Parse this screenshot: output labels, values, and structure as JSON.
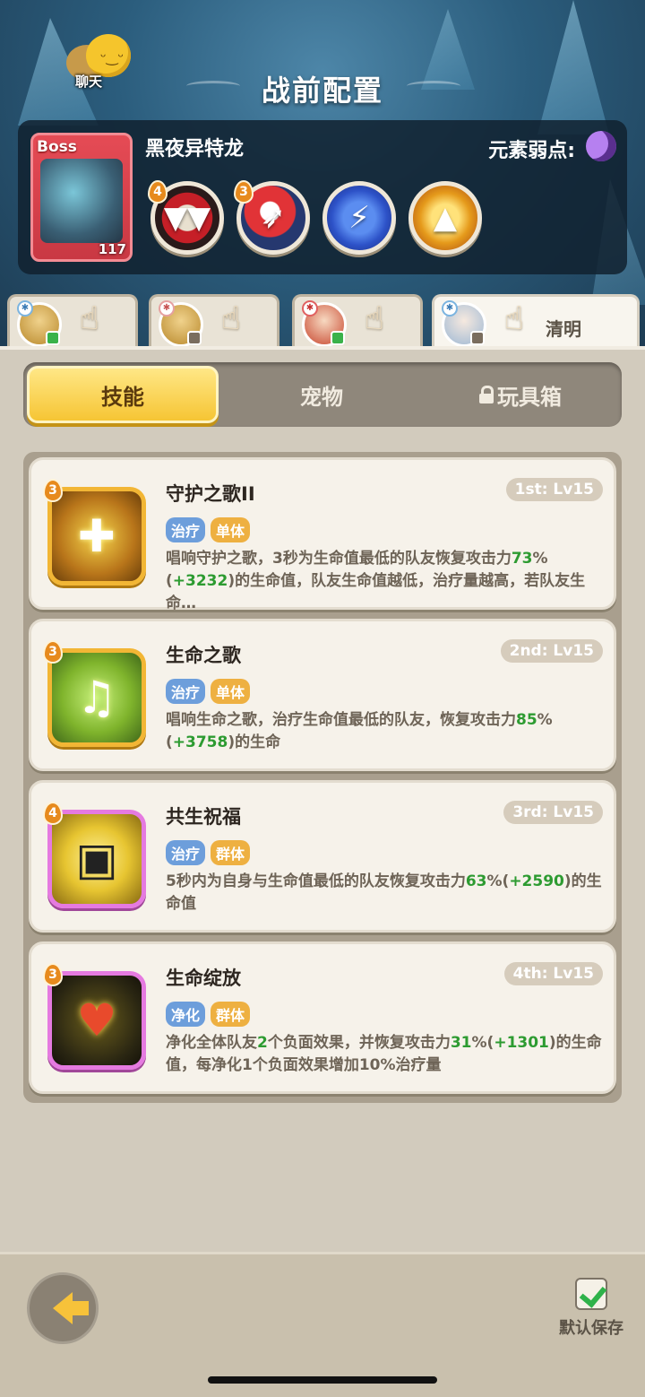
{
  "header": {
    "chat_label": "聊天",
    "title": "战前配置"
  },
  "boss": {
    "tag": "Boss",
    "level": "117",
    "name": "黑夜异特龙",
    "weakness_label": "元素弱点:",
    "weakness_icon": "moon-icon",
    "skills": [
      {
        "icon": "fang-maw-icon",
        "badge": "4"
      },
      {
        "icon": "bird-strike-icon",
        "badge": "3"
      },
      {
        "icon": "lightning-icon",
        "badge": ""
      },
      {
        "icon": "golden-spikes-icon",
        "badge": ""
      }
    ]
  },
  "team": {
    "slots": [
      {
        "hero": "dragon-hero",
        "name": ""
      },
      {
        "hero": "dragon-hero-2",
        "name": ""
      },
      {
        "hero": "red-hair-hero",
        "name": ""
      },
      {
        "hero": "silver-hair-hero",
        "name": "清明"
      }
    ]
  },
  "tabs": {
    "skills": "技能",
    "pets": "宠物",
    "toybox": "玩具箱"
  },
  "skills": [
    {
      "badge": "3",
      "name": "守护之歌II",
      "rank": "1st: Lv15",
      "tags": [
        "治疗",
        "单体"
      ],
      "desc_a": "唱响守护之歌，3秒为生命值最低的队友恢复攻击力",
      "pct": "73",
      "desc_b": "%(",
      "bonus": "+3232",
      "desc_c": ")的生命值，队友生命值越低，治疗量越高，若队友生命…"
    },
    {
      "badge": "3",
      "name": "生命之歌",
      "rank": "2nd: Lv15",
      "tags": [
        "治疗",
        "单体"
      ],
      "desc_a": "唱响生命之歌，治疗生命值最低的队友，恢复攻击力",
      "pct": "85",
      "desc_b": "%(",
      "bonus": "+3758",
      "desc_c": ")的生命"
    },
    {
      "badge": "4",
      "name": "共生祝福",
      "rank": "3rd: Lv15",
      "tags": [
        "治疗",
        "群体"
      ],
      "desc_a": "5秒内为自身与生命值最低的队友恢复攻击力",
      "pct": "63",
      "desc_b": "%(",
      "bonus": "+2590",
      "desc_c": ")的生命值"
    },
    {
      "badge": "3",
      "name": "生命绽放",
      "rank": "4th: Lv15",
      "tags": [
        "净化",
        "群体"
      ],
      "desc_a": "净化全体队友",
      "count": "2",
      "desc_a2": "个负面效果，并恢复攻击力",
      "pct": "31",
      "desc_b": "%(",
      "bonus": "+1301",
      "desc_c": ")的生命值，每净化1个负面效果增加10%治疗量"
    }
  ],
  "footer": {
    "save_label": "默认保存"
  },
  "colors": {
    "accent_yellow": "#f6c534",
    "highlight_green": "#2d9b31",
    "tag_blue": "#6d9edb",
    "tag_orange": "#eeb041"
  }
}
